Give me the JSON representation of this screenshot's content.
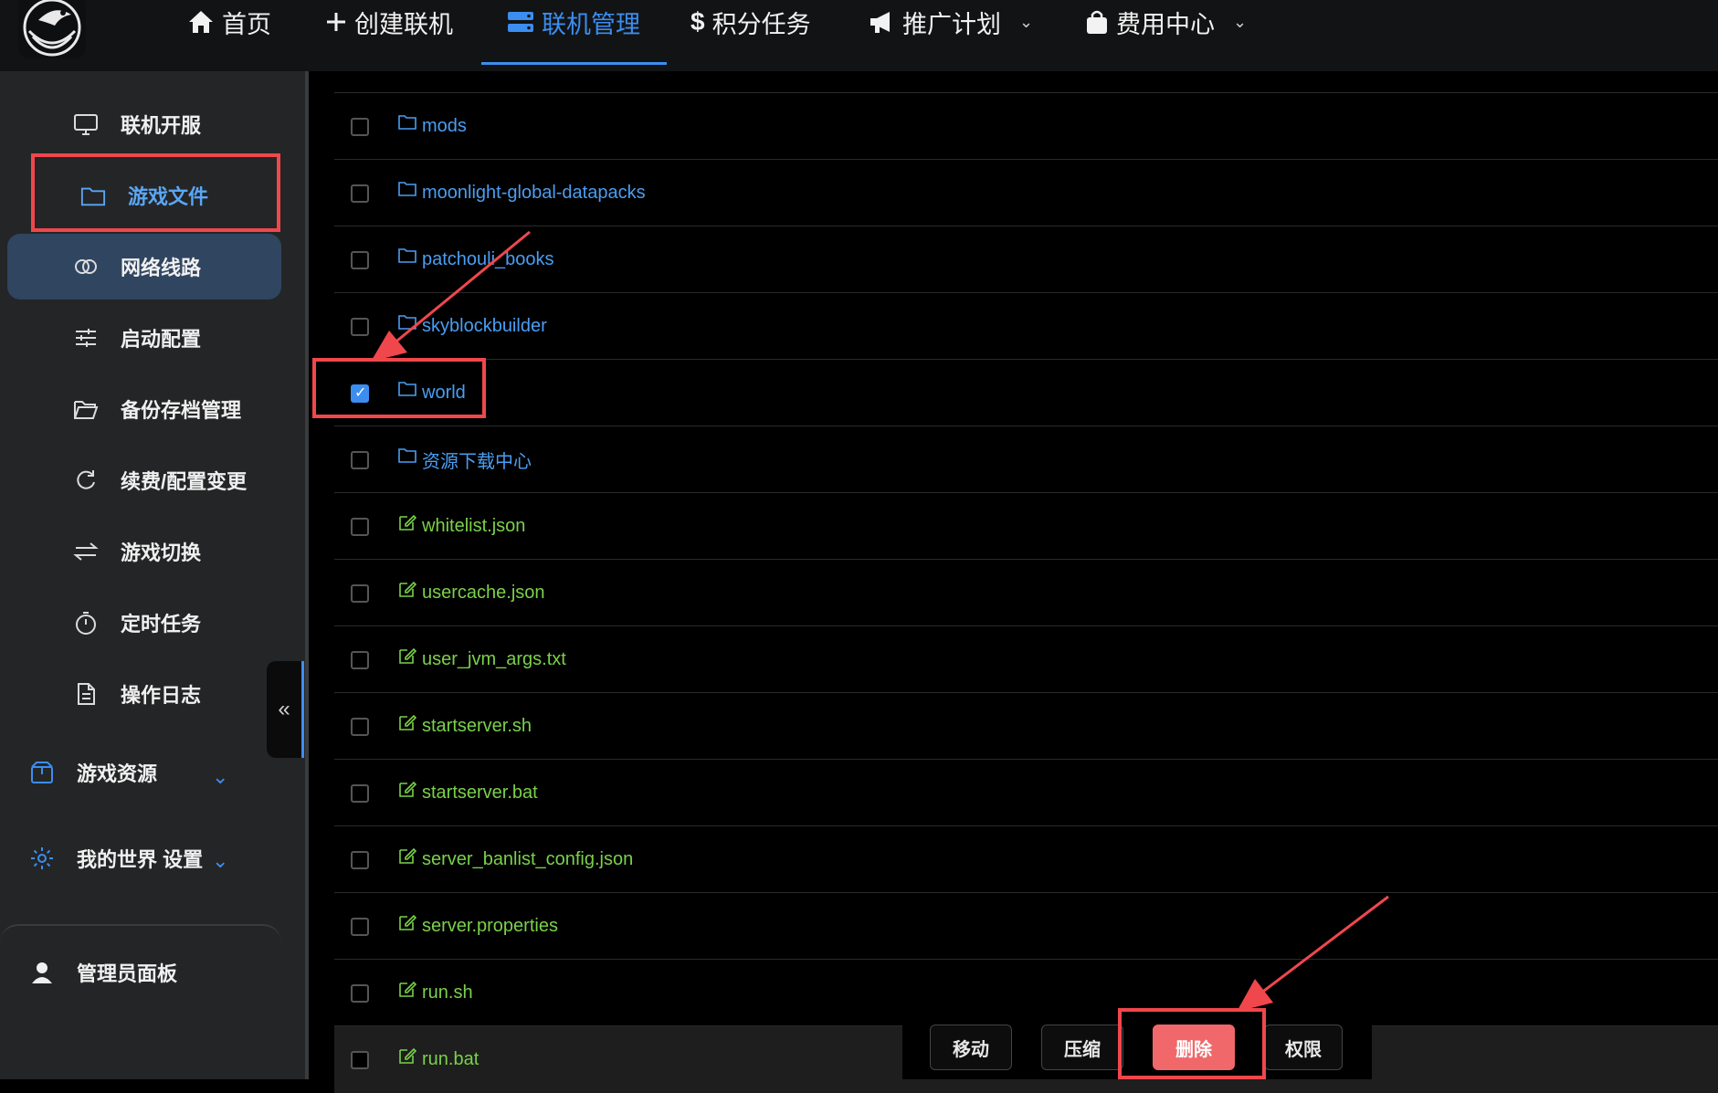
{
  "nav": {
    "items": [
      {
        "label": "首页",
        "icon": "home-icon"
      },
      {
        "label": "创建联机",
        "icon": "plus-icon"
      },
      {
        "label": "联机管理",
        "icon": "server-icon",
        "active": true
      },
      {
        "label": "积分任务",
        "icon": "dollar-icon"
      },
      {
        "label": "推广计划",
        "icon": "megaphone-icon",
        "dropdown": true
      },
      {
        "label": "费用中心",
        "icon": "bag-icon",
        "dropdown": true
      }
    ],
    "accent": "#3b8ef0"
  },
  "sidebar": {
    "items": [
      {
        "label": "联机开服",
        "icon": "monitor-icon"
      },
      {
        "label": "游戏文件",
        "icon": "folder-icon",
        "active": true
      },
      {
        "label": "网络线路",
        "icon": "link-icon"
      },
      {
        "label": "启动配置",
        "icon": "sliders-icon"
      },
      {
        "label": "备份存档管理",
        "icon": "folder-open-icon"
      },
      {
        "label": "续费/配置变更",
        "icon": "refresh-icon"
      },
      {
        "label": "游戏切换",
        "icon": "switch-icon"
      },
      {
        "label": "定时任务",
        "icon": "timer-icon"
      },
      {
        "label": "操作日志",
        "icon": "document-icon"
      }
    ],
    "groups": [
      {
        "label": "游戏资源",
        "icon": "box-icon"
      },
      {
        "label": "我的世界 设置",
        "icon": "gear-icon"
      }
    ],
    "admin": {
      "label": "管理员面板",
      "icon": "user-icon"
    },
    "collapse_glyph": "«"
  },
  "files": [
    {
      "name": "mods",
      "type": "folder",
      "checked": false
    },
    {
      "name": "moonlight-global-datapacks",
      "type": "folder",
      "checked": false
    },
    {
      "name": "patchouli_books",
      "type": "folder",
      "checked": false
    },
    {
      "name": "skyblockbuilder",
      "type": "folder",
      "checked": false
    },
    {
      "name": "world",
      "type": "folder",
      "checked": true
    },
    {
      "name": "资源下载中心",
      "type": "folder",
      "checked": false
    },
    {
      "name": "whitelist.json",
      "type": "file",
      "checked": false
    },
    {
      "name": "usercache.json",
      "type": "file",
      "checked": false
    },
    {
      "name": "user_jvm_args.txt",
      "type": "file",
      "checked": false
    },
    {
      "name": "startserver.sh",
      "type": "file",
      "checked": false
    },
    {
      "name": "startserver.bat",
      "type": "file",
      "checked": false
    },
    {
      "name": "server_banlist_config.json",
      "type": "file",
      "checked": false
    },
    {
      "name": "server.properties",
      "type": "file",
      "checked": false
    },
    {
      "name": "run.sh",
      "type": "file",
      "checked": false
    },
    {
      "name": "run.bat",
      "type": "file",
      "checked": false
    }
  ],
  "actions": {
    "move": "移动",
    "compress": "压缩",
    "delete": "删除",
    "permissions": "权限"
  },
  "colors": {
    "folder": "#4a9ef2",
    "file": "#7ad14a",
    "danger": "#f0686a",
    "highlight": "#f0474c"
  }
}
